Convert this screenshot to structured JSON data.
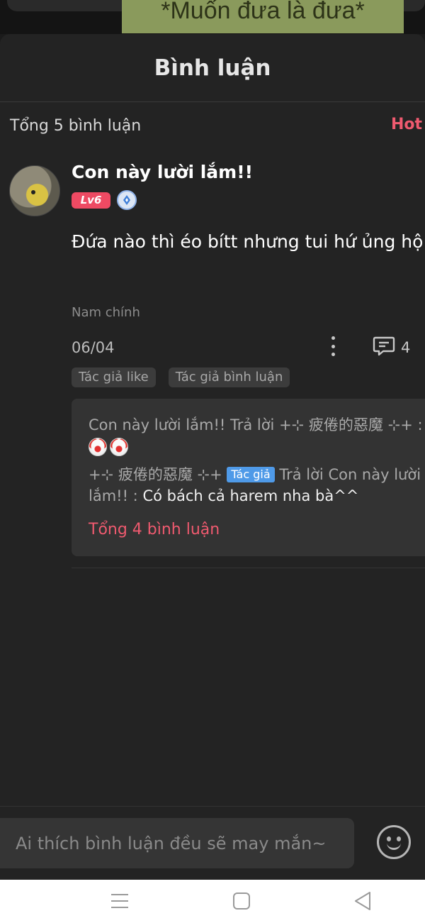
{
  "background": {
    "banner_text": "*Muốn đưa là đưa*"
  },
  "sheet": {
    "title": "Bình luận"
  },
  "summary": {
    "total_label": "Tổng 5 bình luận",
    "sort_label": "Hot"
  },
  "comment": {
    "username": "Con này lười lắm!!",
    "level": "Lv6",
    "text": "Đứa nào thì éo bítt nhưng tui hứ ủng hộ",
    "tag": "Nam chính",
    "date": "06/04",
    "reply_count": "4",
    "chips": [
      "Tác giả like",
      "Tác giả bình luận"
    ],
    "replies": {
      "line1_prefix": "Con này lười lắm!! Trả lời +⊹ 疲倦的惡魔 ⊹+ :",
      "line2_author": "+⊹ 疲倦的惡魔 ⊹+",
      "author_badge": "Tác giả",
      "line2_reply_to": "Trả lời Con này lười lắm!! :",
      "line2_text": "Có bách cả harem nha bà^^",
      "total_label": "Tổng 4 bình luận"
    }
  },
  "input": {
    "placeholder": "Ai thích bình luận đều sẽ may mắn~"
  },
  "icons": {
    "vip": "vip-diamond-icon",
    "more": "more-vertical-icon",
    "reply": "comment-icon",
    "emoji": "smiley-icon",
    "nav_menu": "menu-icon",
    "nav_home": "home-square-icon",
    "nav_back": "back-triangle-icon"
  },
  "colors": {
    "accent": "#ef5a6f",
    "level_badge": "#ee4a63",
    "author_badge": "#4f9ae8",
    "background": "#232323"
  }
}
